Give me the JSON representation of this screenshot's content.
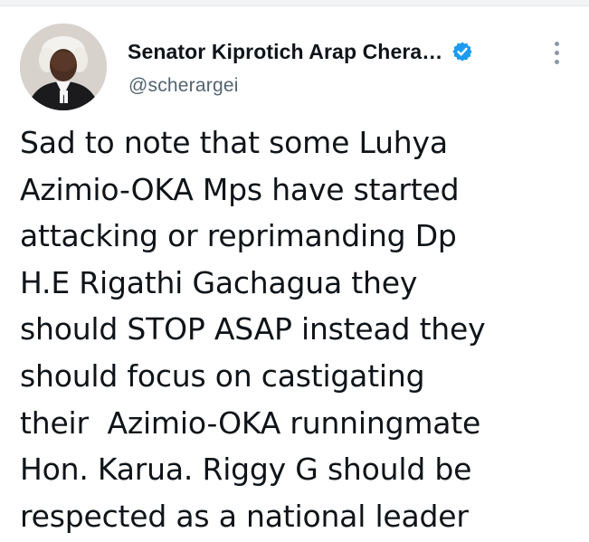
{
  "tweet": {
    "author": {
      "display_name": "Senator Kiprotich Arap Chera…",
      "handle": "@scherargei",
      "verified_icon": "verified-badge-icon",
      "avatar": "profile-photo"
    },
    "more_icon": "more-options-icon",
    "text_lines": [
      "Sad to note that some Luhya",
      "Azimio-OKA Mps have started",
      "attacking or reprimanding Dp",
      "H.E Rigathi Gachagua they",
      "should STOP ASAP instead they",
      "should focus on castigating",
      "their  Azimio-OKA runningmate",
      "Hon. Karua. Riggy G should be",
      "respected as a national leader"
    ]
  },
  "colors": {
    "text": "#0f1419",
    "secondary_text": "#536471",
    "verified_blue": "#1d9bf0"
  }
}
